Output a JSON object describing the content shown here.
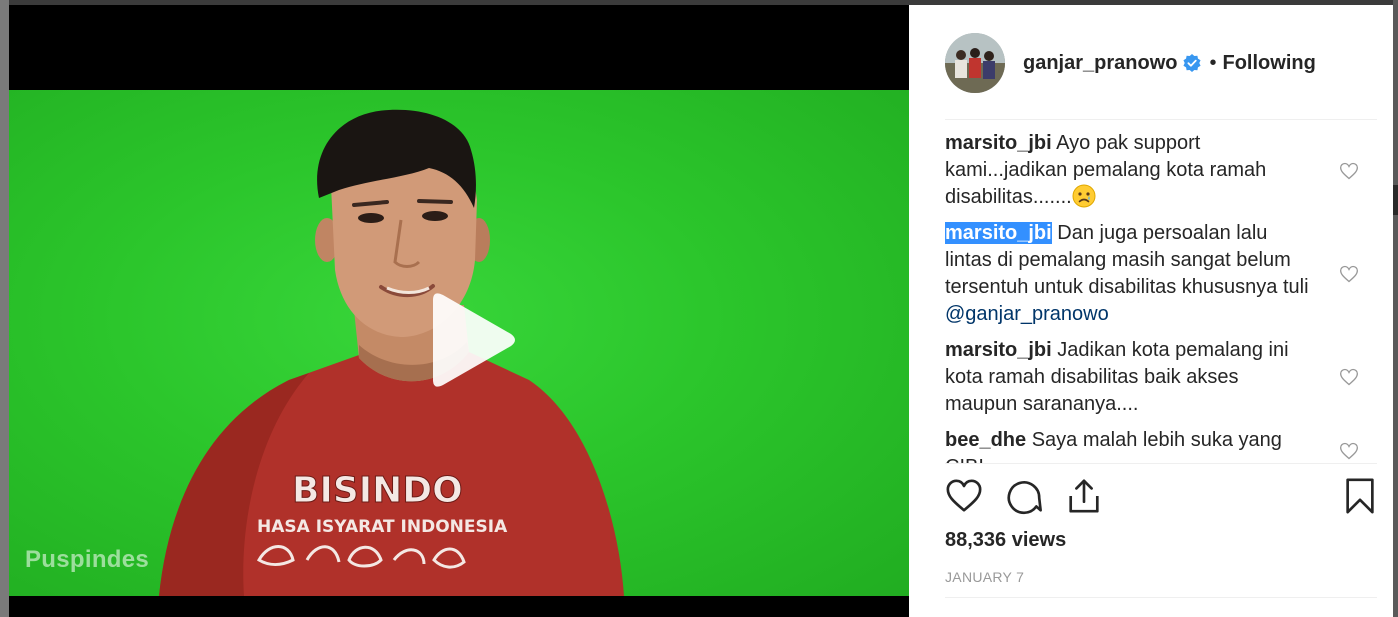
{
  "video": {
    "watermark": "Puspindes",
    "shirt_title": "BISINDO",
    "shirt_subtitle": "HASA ISYARAT INDONESIA"
  },
  "post": {
    "username": "ganjar_pranowo",
    "separator": "•",
    "follow_status": "Following",
    "views": "88,336 views",
    "date": "JANUARY 7"
  },
  "comments": [
    {
      "user": "marsito_jbi",
      "text": "Ayo pak support kami...jadikan pemalang kota ramah disabilitas.......",
      "emoji": "sad-face"
    },
    {
      "user": "marsito_jbi",
      "text": "Dan juga persoalan lalu lintas di pemalang masih sangat belum tersentuh untuk disabilitas khususnya tuli",
      "mention": "@ganjar_pranowo"
    },
    {
      "user": "marsito_jbi",
      "text": "Jadikan kota pemalang ini kota ramah disabilitas baik akses maupun sarananya...."
    },
    {
      "user": "bee_dhe",
      "text": "Saya malah lebih suka yang CIBI"
    }
  ],
  "icons": {
    "verified": "verified-badge-icon",
    "like": "heart-icon",
    "comment": "comment-bubble-icon",
    "share": "share-icon",
    "save": "bookmark-icon",
    "play": "play-icon"
  },
  "colors": {
    "verified": "#3897f0",
    "mention": "#003569",
    "selection": "#3390ff",
    "green_screen": "#2bc52b"
  }
}
